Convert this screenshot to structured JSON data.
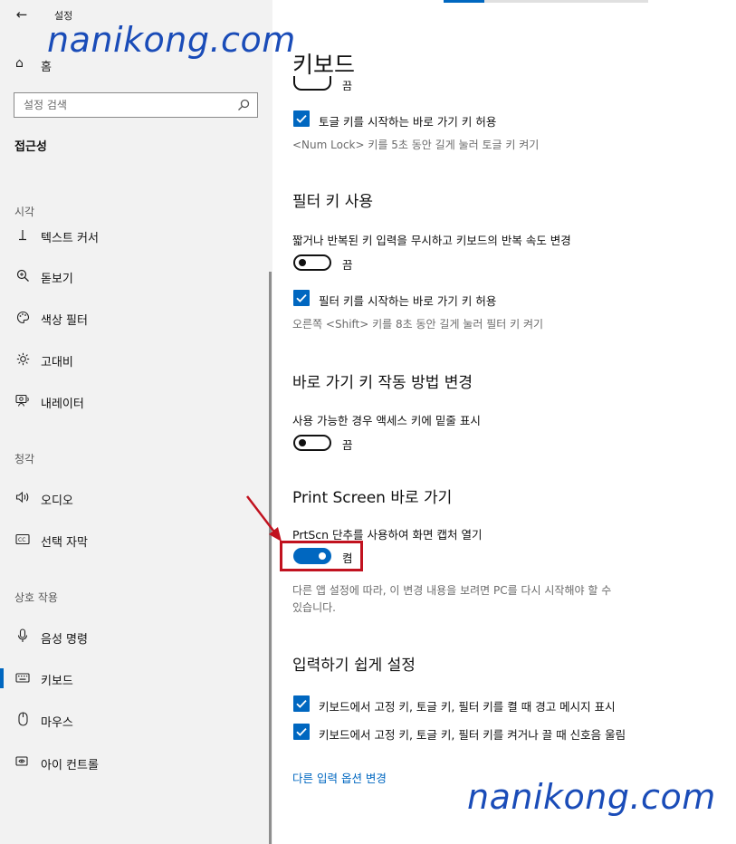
{
  "window": {
    "title": "설정"
  },
  "sidebar": {
    "home_label": "홈",
    "search": {
      "placeholder": "설정 검색"
    },
    "section_title": "접근성",
    "groups": [
      {
        "label": "시각",
        "items": [
          {
            "label": "텍스트 커서",
            "icon": "text-cursor-icon"
          },
          {
            "label": "돋보기",
            "icon": "magnifier-icon"
          },
          {
            "label": "색상 필터",
            "icon": "palette-icon"
          },
          {
            "label": "고대비",
            "icon": "brightness-icon"
          },
          {
            "label": "내레이터",
            "icon": "narrator-icon"
          }
        ]
      },
      {
        "label": "청각",
        "items": [
          {
            "label": "오디오",
            "icon": "speaker-icon"
          },
          {
            "label": "선택 자막",
            "icon": "captions-icon"
          }
        ]
      },
      {
        "label": "상호 작용",
        "items": [
          {
            "label": "음성 명령",
            "icon": "microphone-icon"
          },
          {
            "label": "키보드",
            "icon": "keyboard-icon",
            "active": true
          },
          {
            "label": "마우스",
            "icon": "mouse-icon"
          },
          {
            "label": "아이 컨트롤",
            "icon": "eye-control-icon"
          }
        ]
      }
    ]
  },
  "main": {
    "title": "키보드",
    "top_toggle_state": "끔",
    "sticky_shortcut": {
      "checkbox_label": "토글 키를 시작하는 바로 가기 키 허용",
      "sub": "<Num Lock> 키를 5초 동안 길게 눌러 토글 키 켜기"
    },
    "filter_keys": {
      "heading": "필터 키 사용",
      "desc": "짧거나 반복된 키 입력을 무시하고 키보드의 반복 속도 변경",
      "toggle_state": "끔",
      "checkbox_label": "필터 키를 시작하는 바로 가기 키 허용",
      "sub": "오른쪽 <Shift> 키를 8초 동안 길게 눌러 필터 키 켜기"
    },
    "shortcut_change": {
      "heading": "바로 가기 키 작동 방법 변경",
      "desc": "사용 가능한 경우 액세스 키에 밑줄 표시",
      "toggle_state": "끔"
    },
    "print_screen": {
      "heading": "Print Screen 바로 가기",
      "desc": "PrtScn 단추를 사용하여 화면 캡처 열기",
      "toggle_state": "켬",
      "note_line1": "다른 앱 설정에 따라, 이 변경 내용을 보려면 PC를 다시 시작해야 할 수",
      "note_line2": "있습니다."
    },
    "typing": {
      "heading": "입력하기 쉽게 설정",
      "check1": "키보드에서 고정 키, 토글 키, 필터 키를 켤 때 경고 메시지 표시",
      "check2": "키보드에서 고정 키, 토글 키, 필터 키를 켜거나 끌 때 신호음 울림"
    },
    "link": "다른 입력 옵션 변경"
  },
  "watermarks": [
    "nanikong.com",
    "nanikong.com"
  ],
  "colors": {
    "accent": "#0067c0",
    "sidebar_bg": "#f2f2f2",
    "annotation": "#c1121f",
    "watermark": "#1a4cb8"
  }
}
